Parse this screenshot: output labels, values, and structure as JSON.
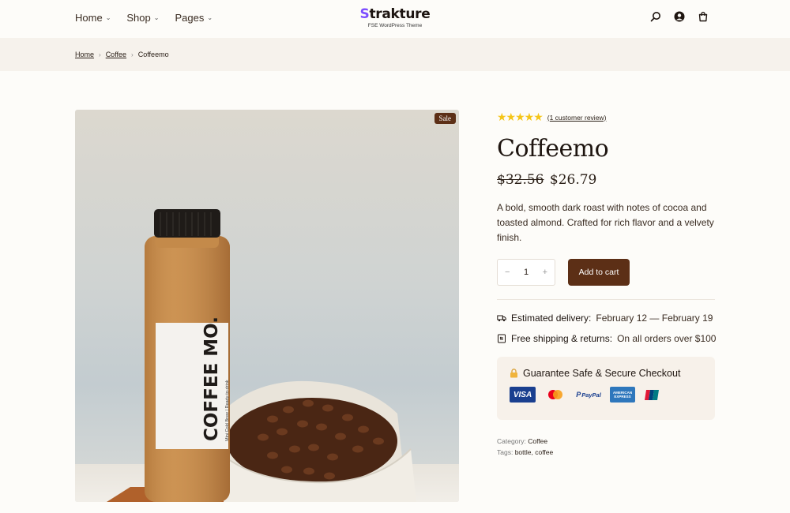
{
  "header": {
    "nav": [
      {
        "label": "Home"
      },
      {
        "label": "Shop"
      },
      {
        "label": "Pages"
      }
    ],
    "logo_s": "S",
    "logo_rest": "trakture",
    "logo_sub": "FSE WordPress Theme"
  },
  "breadcrumb": {
    "home": "Home",
    "category": "Coffee",
    "current": "Coffeemo"
  },
  "product": {
    "sale_badge": "Sale",
    "stars": "★★★★★",
    "rating": 5,
    "review_link": "(1 customer review)",
    "title": "Coffeemo",
    "old_price": "$32.56",
    "price": "$26.79",
    "description": "A bold, smooth dark roast with notes of cocoa and toasted almond. Crafted for rich flavor and a velvety finish.",
    "qty_minus": "−",
    "quantity": "1",
    "qty_plus": "+",
    "add_to_cart": "Add to cart",
    "delivery_label": "Estimated delivery:",
    "delivery_value": "February 12 — February 19",
    "shipping_label": "Free shipping & returns:",
    "shipping_value": "On all orders over $100",
    "guarantee_title": "Guarantee Safe & Secure Checkout",
    "category_label": "Category:",
    "category_value": "Coffee",
    "tags_label": "Tags:",
    "tags_value": "bottle, coffee"
  },
  "bottle_label": {
    "brand": "COFFEE MO.",
    "tagline": "Mini Cold Brew | Ready-to-drink"
  },
  "payment_cards": [
    "VISA",
    "PayPal",
    "AMERICAN EXPRESS"
  ],
  "colors": {
    "accent": "#5c2f16",
    "star": "#f5c518",
    "crumb_bg": "#f6f2ec",
    "guarantee_bg": "#f7f1ea"
  }
}
